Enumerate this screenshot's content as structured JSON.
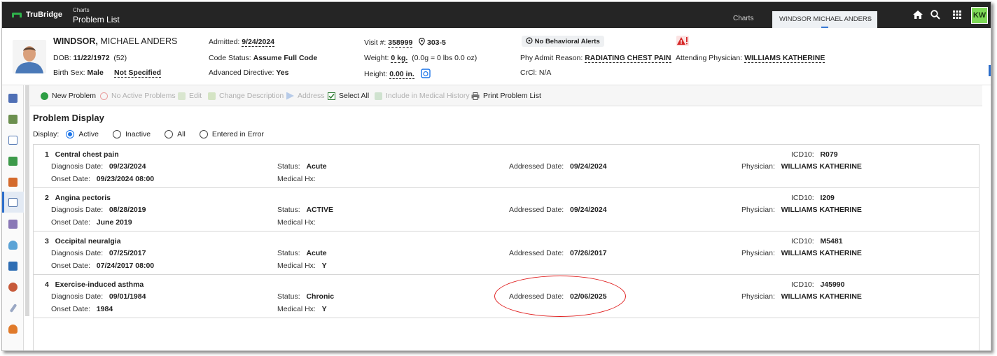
{
  "app": {
    "brand": "TruBridge",
    "breadcrumb_small": "Charts",
    "breadcrumb_title": "Problem List",
    "tab_charts": "Charts",
    "tab_patient": "WINDSOR MICHAEL ANDERS",
    "tab_close": "×",
    "user_initials": "KW",
    "icons": [
      "home-icon",
      "search-icon",
      "apps-grid-icon"
    ]
  },
  "patient": {
    "last_name": "WINDSOR,",
    "first_names": " MICHAEL ANDERS",
    "dob_label": "DOB:",
    "dob": "11/22/1972",
    "age": "(52)",
    "birth_sex_label": "Birth Sex:",
    "birth_sex": "Male",
    "gender": "Not Specified",
    "admitted_label": "Admitted:",
    "admitted": "9/24/2024",
    "code_status_label": "Code Status:",
    "code_status": "Assume Full Code",
    "adv_directive_label": "Advanced Directive:",
    "adv_directive": "Yes",
    "visit_label": "Visit #:",
    "visit": "358999",
    "room": "303-5",
    "weight_label": "Weight:",
    "weight": "0 kg.",
    "weight_note": "(0.0g = 0 lbs 0.0 oz)",
    "height_label": "Height:",
    "height": "0.00 in.",
    "behavioral_alerts": "No Behavioral Alerts",
    "phy_admit_reason_label": "Phy Admit Reason:",
    "phy_admit_reason": "RADIATING CHEST PAIN",
    "crcl_label": "CrCl:",
    "crcl": "N/A",
    "attending_label": "Attending Physician:",
    "attending": "WILLIAMS KATHERINE"
  },
  "toolbar": {
    "new_problem": "New Problem",
    "no_active": "No Active Problems",
    "edit": "Edit",
    "change_desc": "Change Description",
    "address": "Address",
    "select_all": "Select All",
    "include_hx": "Include in Medical History",
    "print": "Print Problem List"
  },
  "display": {
    "title": "Problem Display",
    "label": "Display:",
    "options": [
      "Active",
      "Inactive",
      "All",
      "Entered in Error"
    ],
    "selected": "Active"
  },
  "labels": {
    "diagnosis_date": "Diagnosis Date:",
    "onset_date": "Onset Date:",
    "status": "Status:",
    "medical_hx": "Medical Hx:",
    "addressed_date": "Addressed Date:",
    "icd10": "ICD10:",
    "physician": "Physician:"
  },
  "problems": [
    {
      "num": "1",
      "title": "Central chest pain",
      "diagnosis_date": "09/23/2024",
      "onset_date": "09/23/2024 08:00",
      "status": "Acute",
      "medical_hx": "",
      "addressed_date": "09/24/2024",
      "icd10": "R079",
      "physician": "WILLIAMS KATHERINE"
    },
    {
      "num": "2",
      "title": "Angina pectoris",
      "diagnosis_date": "08/28/2019",
      "onset_date": "June 2019",
      "status": "ACTIVE",
      "medical_hx": "",
      "addressed_date": "09/24/2024",
      "icd10": "I209",
      "physician": "WILLIAMS KATHERINE"
    },
    {
      "num": "3",
      "title": "Occipital neuralgia",
      "diagnosis_date": "07/25/2017",
      "onset_date": "07/24/2017 08:00",
      "status": "Acute",
      "medical_hx": "Y",
      "addressed_date": "07/26/2017",
      "icd10": "M5481",
      "physician": "WILLIAMS KATHERINE"
    },
    {
      "num": "4",
      "title": "Exercise-induced asthma",
      "diagnosis_date": "09/01/1984",
      "onset_date": "1984",
      "status": "Chronic",
      "medical_hx": "Y",
      "addressed_date": "02/06/2025",
      "icd10": "J45990",
      "physician": "WILLIAMS KATHERINE"
    }
  ],
  "colors": {
    "topbar": "#252525",
    "accent": "#2c6ecb",
    "brand_green": "#2fb24b",
    "avatar_bg": "#7ed957",
    "annotation_red": "#e02020"
  }
}
